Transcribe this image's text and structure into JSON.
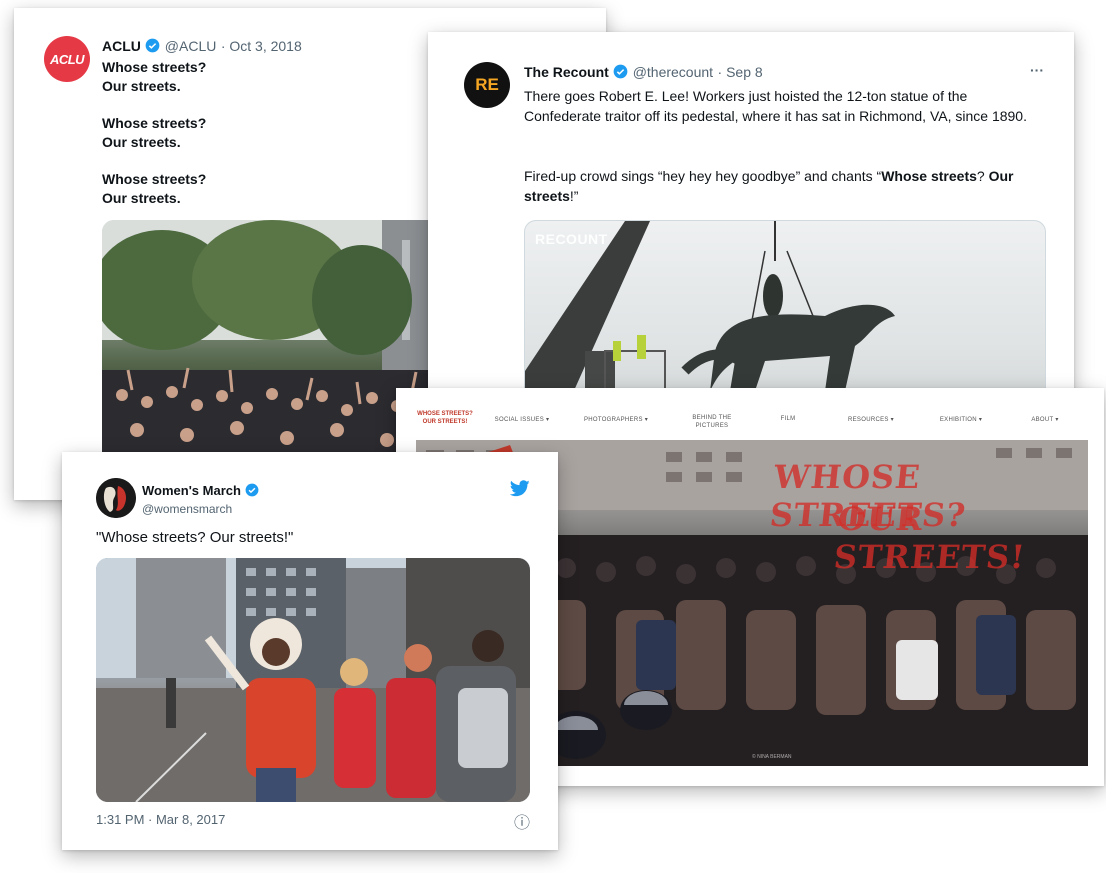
{
  "aclu": {
    "avatar_text": "ACLU",
    "name": "ACLU",
    "handle": "@ACLU",
    "date": "· Oct 3, 2018",
    "lines": [
      {
        "q": "Whose streets?",
        "a": "Our streets."
      },
      {
        "q": "Whose streets?",
        "a": "Our streets."
      },
      {
        "q": "Whose streets?",
        "a": "Our streets."
      }
    ],
    "colors": {
      "avatar": "#e63946"
    }
  },
  "recount": {
    "avatar_text": "RE",
    "name": "The Recount",
    "handle": "@therecount",
    "date": "· Sep 8",
    "more": "···",
    "paragraph1": "There goes Robert E. Lee! Workers just hoisted the 12-ton statue of the Confederate traitor off its pedestal, where it has sat in Richmond, VA, since 1890.",
    "p2_before": "Fired-up crowd sings “hey hey hey goodbye” and chants “",
    "p2_bold1": "Whose streets",
    "p2_mid": "? ",
    "p2_bold2": "Our streets",
    "p2_after": "!”",
    "watermark": "RECOUNT",
    "colors": {
      "avatar": "#111111",
      "avatar_text": "#f5a623"
    }
  },
  "website": {
    "logo_line1": "WHOSE STREETS?",
    "logo_line2": "OUR STREETS!",
    "nav": [
      "SOCIAL ISSUES ▾",
      "PHOTOGRAPHERS ▾",
      "BEHIND THE PICTURES",
      "FILM",
      "RESOURCES ▾",
      "EXHIBITION ▾",
      "ABOUT ▾"
    ],
    "hero_line1": "WHOSE STREETS?",
    "hero_line2": "OUR STREETS!",
    "credit": "© NINA BERMAN",
    "colors": {
      "brand": "#c0392b"
    }
  },
  "womens": {
    "name": "Women's March",
    "handle": "@womensmarch",
    "text": "\"Whose streets? Our streets!\"",
    "timestamp": "1:31 PM · Mar 8, 2017",
    "info_icon": "ⓘ",
    "colors": {
      "twitter": "#1d9bf0"
    }
  },
  "icons": [
    "verified-badge-icon",
    "twitter-bird-icon",
    "info-icon",
    "more-options-icon"
  ]
}
